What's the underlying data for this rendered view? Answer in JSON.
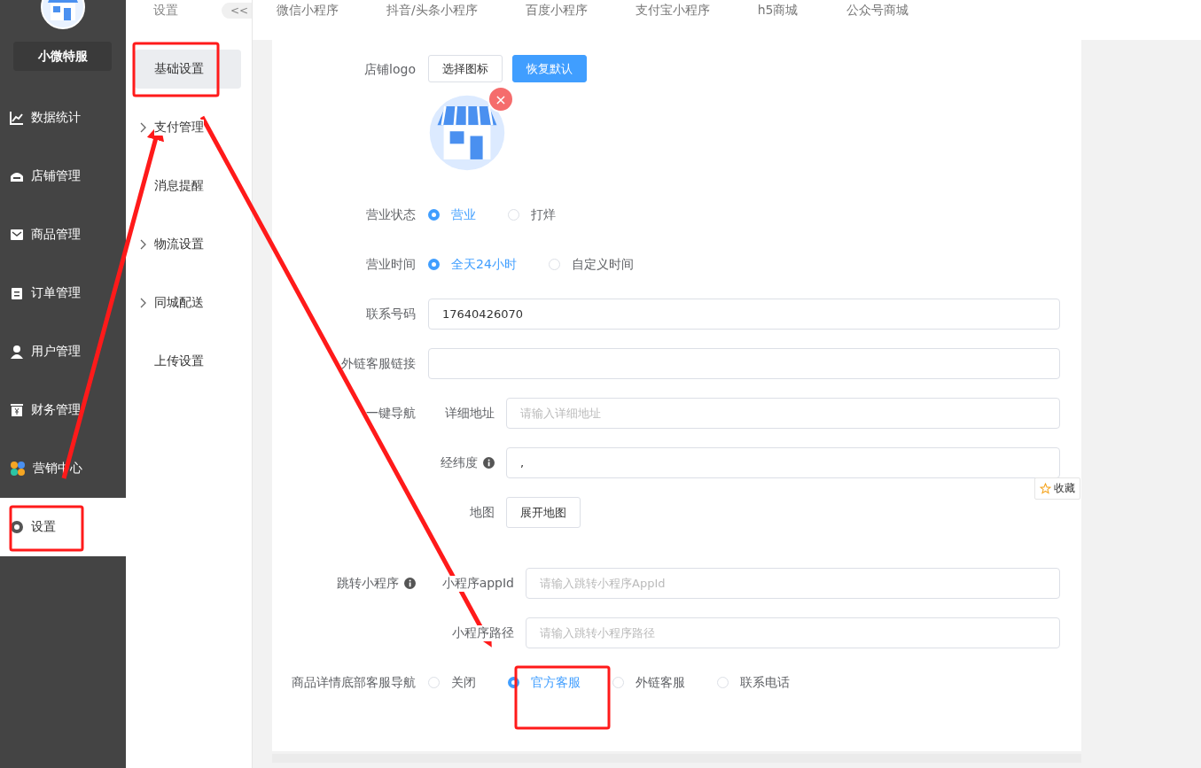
{
  "sidebar": {
    "brand": "小微特服",
    "items": [
      {
        "label": "数据统计",
        "selected": false
      },
      {
        "label": "店铺管理",
        "selected": false
      },
      {
        "label": "商品管理",
        "selected": false
      },
      {
        "label": "订单管理",
        "selected": false
      },
      {
        "label": "用户管理",
        "selected": false
      },
      {
        "label": "财务管理",
        "selected": false
      },
      {
        "label": "营销中心",
        "selected": false
      },
      {
        "label": "设置",
        "selected": true
      }
    ]
  },
  "submenu": {
    "title": "设置",
    "collapse": "<<",
    "items": [
      {
        "label": "基础设置",
        "selected": true,
        "expandable": false
      },
      {
        "label": "支付管理",
        "selected": false,
        "expandable": true
      },
      {
        "label": "消息提醒",
        "selected": false,
        "expandable": false
      },
      {
        "label": "物流设置",
        "selected": false,
        "expandable": true
      },
      {
        "label": "同城配送",
        "selected": false,
        "expandable": true
      },
      {
        "label": "上传设置",
        "selected": false,
        "expandable": false
      }
    ]
  },
  "tabs": [
    "微信小程序",
    "抖音/头条小程序",
    "百度小程序",
    "支付宝小程序",
    "h5商城",
    "公众号商城"
  ],
  "form": {
    "rows": [
      {
        "kind": "logo",
        "label": "店铺logo",
        "buttons": [
          {
            "label": "选择图标",
            "primary": false
          },
          {
            "label": "恢复默认",
            "primary": true
          }
        ],
        "remove": "×"
      },
      {
        "kind": "radio",
        "label": "营业状态",
        "options": [
          {
            "label": "营业",
            "selected": true
          },
          {
            "label": "打烊",
            "selected": false
          }
        ]
      },
      {
        "kind": "radio",
        "label": "营业时间",
        "options": [
          {
            "label": "全天24小时",
            "selected": true
          },
          {
            "label": "自定义时间",
            "selected": false
          }
        ]
      },
      {
        "kind": "input",
        "label": "联系号码",
        "value": "17640426070"
      },
      {
        "kind": "input",
        "label": "外链客服链接"
      },
      {
        "kind": "subinput",
        "label": "一键导航",
        "sublabel": "详细地址",
        "placeholder": "请输入详细地址"
      },
      {
        "kind": "subinput",
        "sublabel": "经纬度",
        "sublabel_info": true,
        "value": ","
      },
      {
        "kind": "subbutton",
        "sublabel": "地图",
        "button": "展开地图"
      },
      {
        "kind": "subinput",
        "label": "跳转小程序",
        "label_info": true,
        "sublabel": "小程序appId",
        "placeholder": "请输入跳转小程序AppId"
      },
      {
        "kind": "subinput",
        "sublabel": "小程序路径",
        "placeholder": "请输入跳转小程序路径"
      },
      {
        "kind": "radio",
        "label": "商品详情底部客服导航",
        "options": [
          {
            "label": "关闭",
            "selected": false
          },
          {
            "label": "官方客服",
            "selected": true
          },
          {
            "label": "外链客服",
            "selected": false
          },
          {
            "label": "联系电话",
            "selected": false
          }
        ]
      }
    ]
  },
  "bookmark": "收藏"
}
